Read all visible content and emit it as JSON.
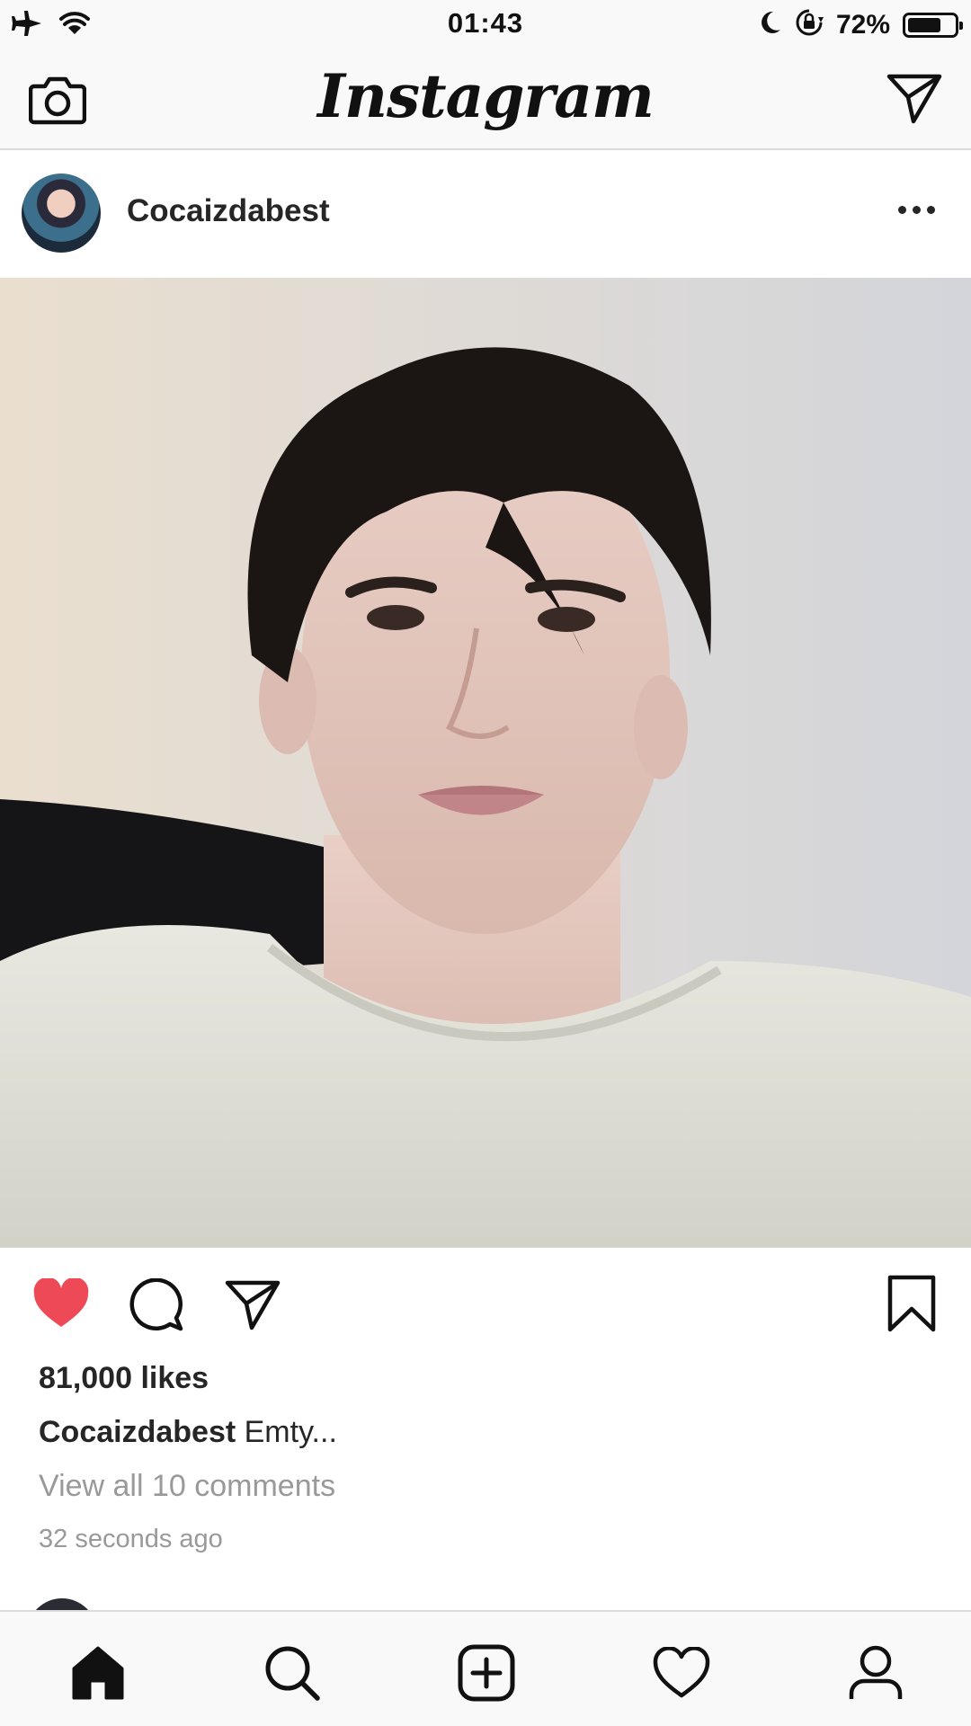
{
  "status_bar": {
    "time": "01:43",
    "battery_percent": "72%",
    "battery_level": 0.72,
    "icons": [
      "airplane-icon",
      "wifi-icon",
      "moon-icon",
      "rotation-lock-icon",
      "battery-icon"
    ]
  },
  "top_nav": {
    "logo": "Instagram",
    "left_icon": "camera-icon",
    "right_icon": "direct-message-icon"
  },
  "post": {
    "username": "Cocaizdabest",
    "likes": "81,000 likes",
    "caption_user": "Cocaizdabest",
    "caption_text": " Emty...",
    "view_comments": "View all 10 comments",
    "timestamp": "32 seconds ago",
    "liked": true
  },
  "colors": {
    "like_red": "#ed4956",
    "text": "#262626",
    "secondary_text": "#999999",
    "bar_bg": "#f9f9f9"
  },
  "tab_bar": {
    "items": [
      "home-icon",
      "search-icon",
      "add-post-icon",
      "activity-heart-icon",
      "profile-icon"
    ],
    "active": "home-icon"
  }
}
